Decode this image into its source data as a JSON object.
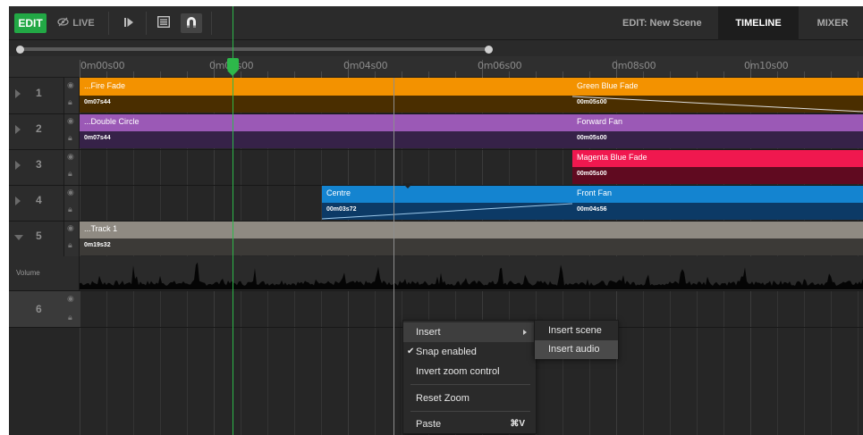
{
  "toolbar": {
    "edit_label": "EDIT",
    "live_label": "LIVE",
    "icons": {
      "live": "eye-slash-icon",
      "play": "step-play-icon",
      "list": "list-icon",
      "magnet": "magnet-icon"
    }
  },
  "header": {
    "scene_label": "EDIT: New Scene",
    "tabs": [
      {
        "label": "TIMELINE",
        "active": true
      },
      {
        "label": "MIXER",
        "active": false
      }
    ]
  },
  "ruler": {
    "labels": [
      "0m00s00",
      "0m02s00",
      "0m04s00",
      "0m06s00",
      "0m08s00",
      "0m10s00"
    ]
  },
  "tracks": [
    {
      "number": "1",
      "expanded": false
    },
    {
      "number": "2",
      "expanded": false
    },
    {
      "number": "3",
      "expanded": false
    },
    {
      "number": "4",
      "expanded": false
    },
    {
      "number": "5",
      "expanded": true
    },
    {
      "number": "6",
      "expanded": false
    }
  ],
  "clips": [
    {
      "track": 1,
      "name": "...Fire Fade",
      "duration": "0m07s44",
      "color": "#f39200",
      "dark": "#4a2e00"
    },
    {
      "track": 1,
      "name": "Green Blue Fade",
      "duration": "00m05s00",
      "color": "#f39200",
      "dark": "#4a2e00"
    },
    {
      "track": 2,
      "name": "...Double Circle",
      "duration": "0m07s44",
      "color": "#9b59b6",
      "dark": "#362248"
    },
    {
      "track": 2,
      "name": "Forward Fan",
      "duration": "00m05s00",
      "color": "#9b59b6",
      "dark": "#362248"
    },
    {
      "track": 3,
      "name": "Magenta Blue Fade",
      "duration": "00m05s00",
      "color": "#f0184f",
      "dark": "#600a20"
    },
    {
      "track": 4,
      "name": "Centre",
      "duration": "00m03s72",
      "color": "#1484d0",
      "dark": "#0c3a66"
    },
    {
      "track": 4,
      "name": "Front Fan",
      "duration": "00m04s56",
      "color": "#1484d0",
      "dark": "#0c3a66"
    },
    {
      "track": 5,
      "name": "...Track 1",
      "duration": "0m19s32",
      "color": "#8f8a82",
      "dark": "#3c3a37"
    }
  ],
  "volume_label": "Volume",
  "context_menu": {
    "items": [
      {
        "label": "Insert",
        "has_submenu": true,
        "checked": false,
        "shortcut": ""
      },
      {
        "label": "Snap enabled",
        "has_submenu": false,
        "checked": true,
        "shortcut": ""
      },
      {
        "label": "Invert zoom control",
        "has_submenu": false,
        "checked": false,
        "shortcut": ""
      },
      {
        "label": "Reset Zoom",
        "has_submenu": false,
        "checked": false,
        "shortcut": ""
      },
      {
        "label": "Paste",
        "has_submenu": false,
        "checked": false,
        "shortcut": "⌘V"
      }
    ],
    "submenu": [
      "Insert scene",
      "Insert audio"
    ]
  }
}
